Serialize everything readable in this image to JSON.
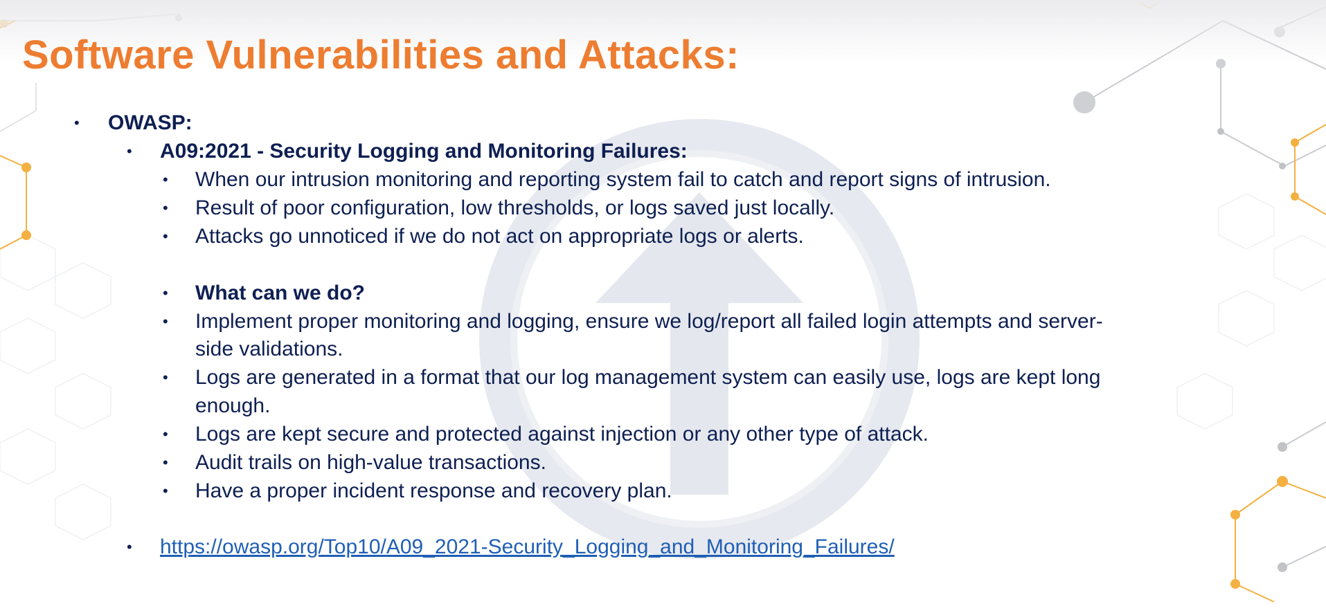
{
  "slide": {
    "title": "Software Vulnerabilities and Attacks:",
    "bullet_char": "•",
    "level1": "OWASP:",
    "level2": "A09:2021 - Security Logging and Monitoring Failures:",
    "points": [
      "When our intrusion monitoring and reporting system fail to catch and report signs of intrusion.",
      "Result of poor configuration, low thresholds, or logs saved just locally.",
      "Attacks go unnoticed if we do not act on appropriate logs or alerts."
    ],
    "subheading": "What can we do?",
    "actions": [
      "Implement proper monitoring and logging, ensure we log/report all failed login attempts and server-",
      "side validations.",
      "Logs are generated in a format that our log management system can easily use, logs are kept long",
      "enough.",
      "Logs are kept secure and protected against injection or any other type of attack.",
      "Audit trails on high-value transactions.",
      "Have a proper incident response and recovery plan."
    ],
    "link": "https://owasp.org/Top10/A09_2021-Security_Logging_and_Monitoring_Failures/"
  },
  "colors": {
    "title": "#ed7d31",
    "text": "#0e1f52",
    "link": "#1f5fb4",
    "accent_orange": "#f4b041",
    "network_gray": "#c7c9cc",
    "watermark": "#dfe3ea"
  }
}
